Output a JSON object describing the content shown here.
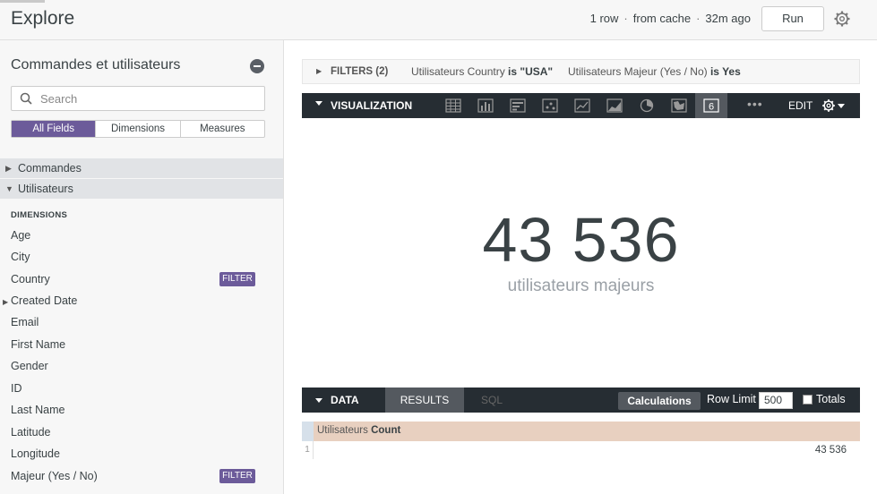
{
  "header": {
    "title": "Explore",
    "row_count": "1 row",
    "cache": "from cache",
    "age": "32m ago",
    "run_label": "Run"
  },
  "sidebar": {
    "model_title": "Commandes et utilisateurs",
    "search_placeholder": "Search",
    "tabs": [
      "All Fields",
      "Dimensions",
      "Measures"
    ],
    "views": [
      "Commandes",
      "Utilisateurs"
    ],
    "section_label": "DIMENSIONS",
    "fields": [
      {
        "label": "Age",
        "badge": ""
      },
      {
        "label": "City",
        "badge": ""
      },
      {
        "label": "Country",
        "badge": "FILTER"
      },
      {
        "label": "Created Date",
        "badge": ""
      },
      {
        "label": "Email",
        "badge": ""
      },
      {
        "label": "First Name",
        "badge": ""
      },
      {
        "label": "Gender",
        "badge": ""
      },
      {
        "label": "ID",
        "badge": ""
      },
      {
        "label": "Last Name",
        "badge": ""
      },
      {
        "label": "Latitude",
        "badge": ""
      },
      {
        "label": "Longitude",
        "badge": ""
      },
      {
        "label": "Majeur (Yes / No)",
        "badge": "FILTER"
      }
    ]
  },
  "filters": {
    "label": "FILTERS (2)",
    "f1_field": "Utilisateurs Country",
    "f1_cond": "is \"USA\"",
    "f2_field": "Utilisateurs Majeur (Yes / No)",
    "f2_cond": "is Yes"
  },
  "visualization": {
    "label": "VISUALIZATION",
    "more": "•••",
    "edit": "EDIT",
    "active_icon_text": "6",
    "icons": [
      "table-icon",
      "bar-chart-icon",
      "column-chart-icon",
      "scatter-icon",
      "line-chart-icon",
      "area-chart-icon",
      "pie-chart-icon",
      "map-icon",
      "single-value-icon"
    ]
  },
  "single_value": {
    "value": "43 536",
    "label": "utilisateurs majeurs"
  },
  "data": {
    "label": "DATA",
    "results": "RESULTS",
    "sql": "SQL",
    "calculations": "Calculations",
    "row_limit_label": "Row Limit",
    "row_limit": "500",
    "totals": "Totals",
    "column_view": "Utilisateurs",
    "column_measure": "Count",
    "row_number": "1",
    "row_value": "43 536"
  },
  "colors": {
    "accent_purple": "#6c5b9a",
    "dark_bar": "#262d33",
    "header_cell": "#e8d0c0"
  }
}
